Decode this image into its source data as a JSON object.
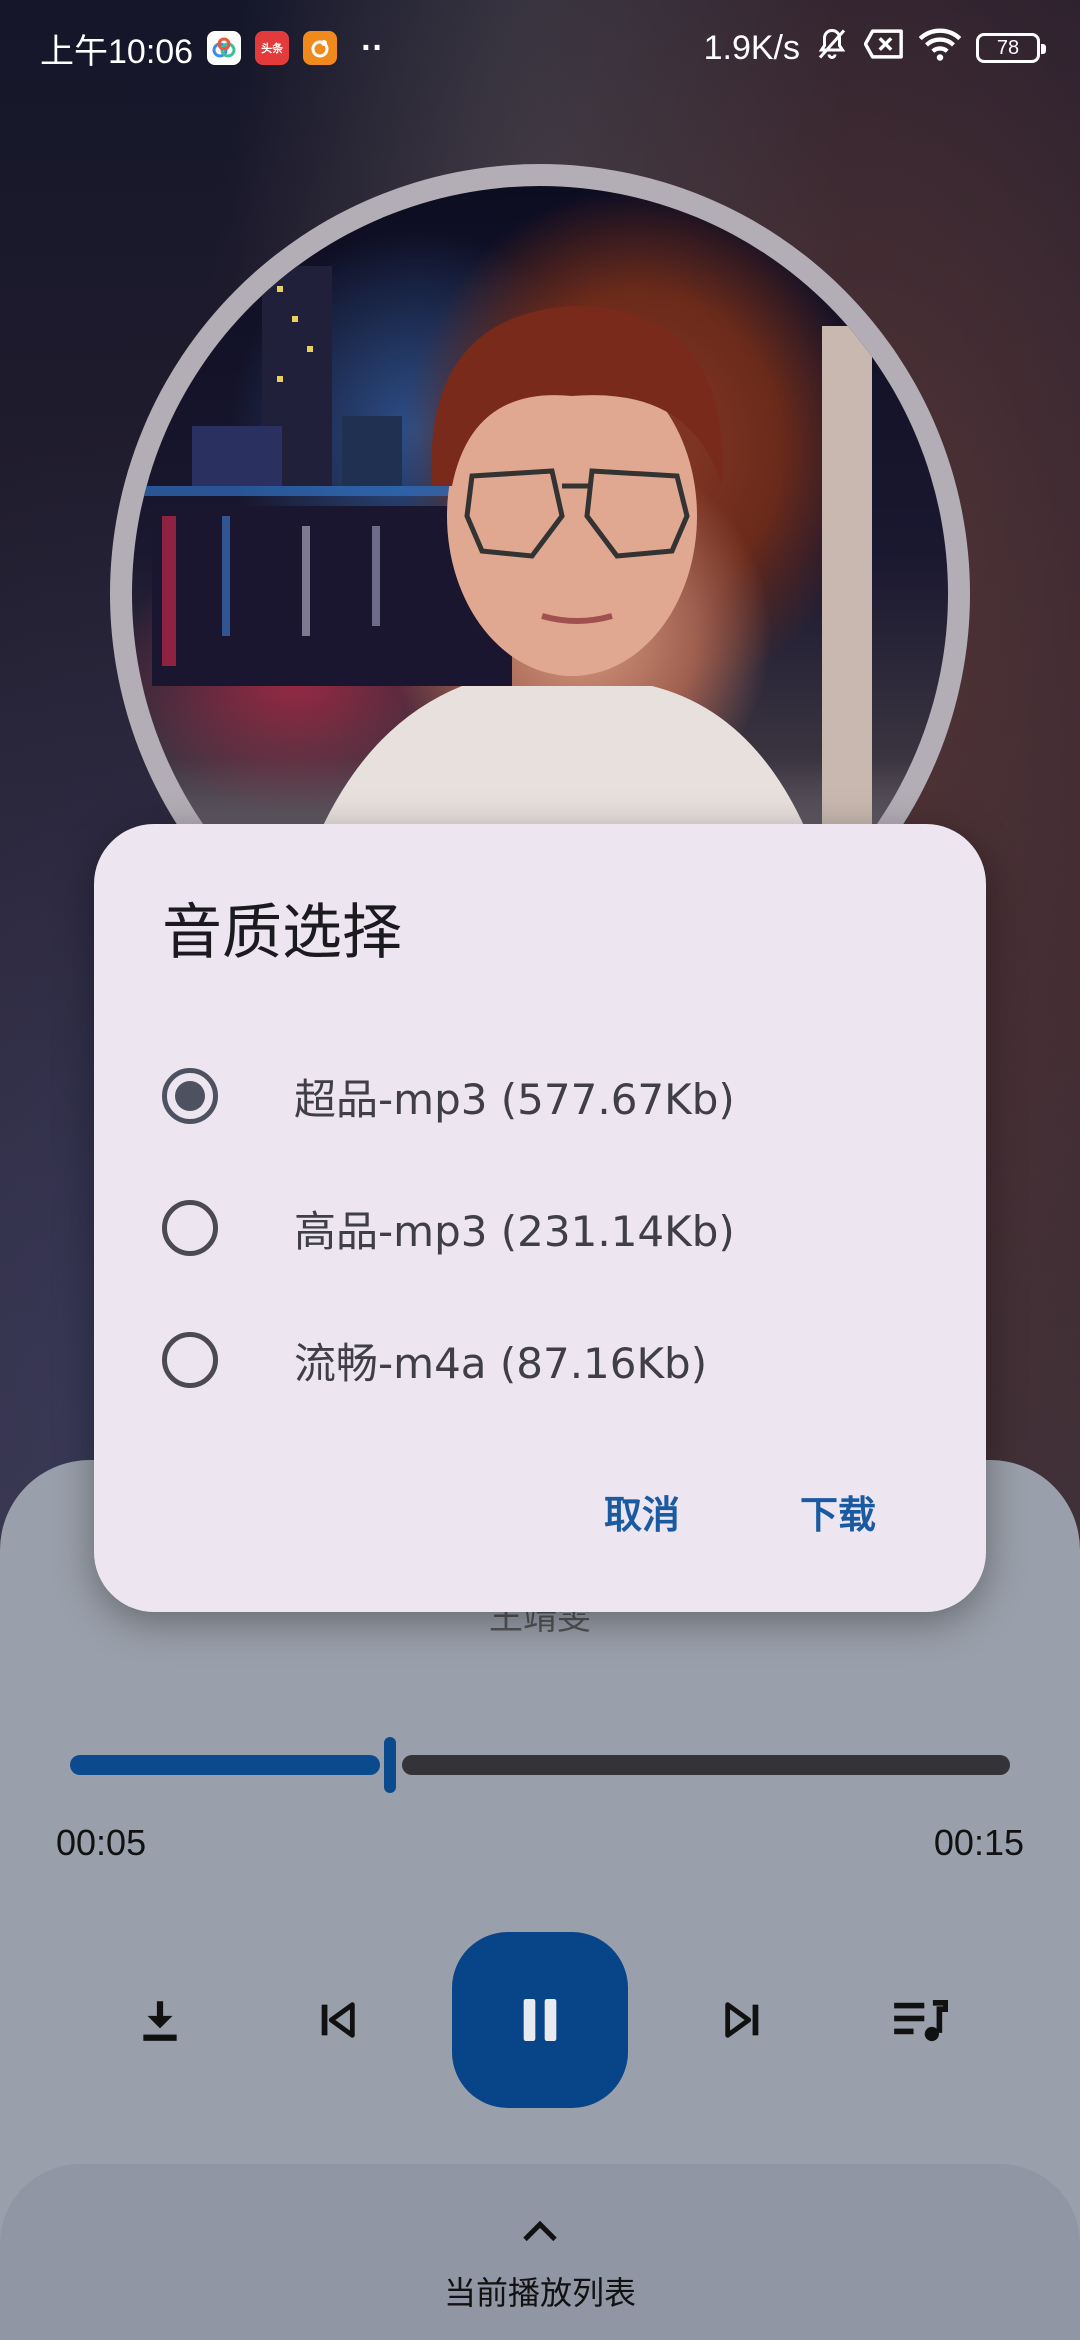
{
  "status_bar": {
    "time": "上午10:06",
    "more": "··",
    "net_speed": "1.9K/s",
    "battery": "78",
    "app_icons": [
      "cloud-app-icon",
      "toutiao-app-icon",
      "orange-app-icon"
    ],
    "toutiao_label": "头条"
  },
  "player": {
    "artist": "王靖雯",
    "time_current": "00:05",
    "time_total": "00:15",
    "progress": 0.34,
    "playing": true
  },
  "controls": {
    "icons": [
      "download-icon",
      "skip-previous-icon",
      "pause-icon",
      "skip-next-icon",
      "playlist-icon"
    ]
  },
  "playlist": {
    "label": "当前播放列表"
  },
  "dialog": {
    "title": "音质选择",
    "options": [
      {
        "label": "超品-mp3 (577.67Kb)",
        "checked": true
      },
      {
        "label": "高品-mp3 (231.14Kb)",
        "checked": false
      },
      {
        "label": "流畅-m4a (87.16Kb)",
        "checked": false
      }
    ],
    "cancel": "取消",
    "confirm": "下载"
  },
  "colors": {
    "accent": "#084488",
    "dialog_bg": "#ede6f0",
    "action_text": "#1a5aa0"
  }
}
